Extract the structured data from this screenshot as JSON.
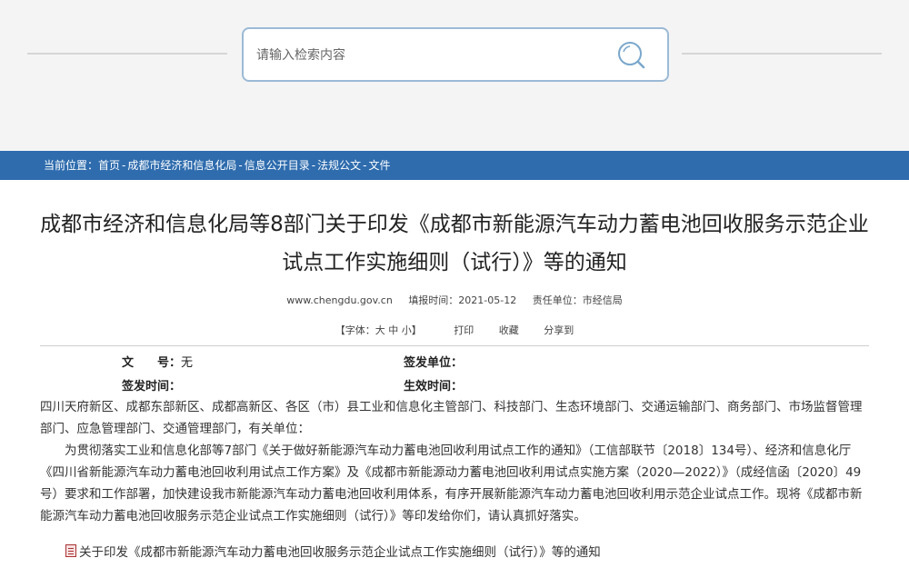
{
  "search": {
    "placeholder": "请输入检索内容"
  },
  "breadcrumb": {
    "prefix": "当前位置：",
    "items": [
      "首页",
      "成都市经济和信息化局",
      "信息公开目录",
      "法规公文",
      "文件"
    ],
    "separator": " - "
  },
  "article": {
    "title_line1": "成都市经济和信息化局等8部门关于印发《成都市新能源汽车动力蓄电池回收服务示范企业",
    "title_line2": "试点工作实施细则（试行）》等的通知",
    "meta": {
      "site": "www.chengdu.gov.cn",
      "date": "填报时间：2021-05-12",
      "unit": "责任单位：市经信局"
    },
    "tools": {
      "font_size": "【字体：大 中 小】",
      "print": "打印",
      "favorite": "收藏",
      "share": "分享到"
    },
    "info": {
      "doc_no_label": "文　　号：",
      "doc_no_value": "无",
      "issuer_label": "签发单位：",
      "issuer_value": "",
      "issue_time_label": "签发时间：",
      "issue_time_value": "",
      "effective_label": "生效时间：",
      "effective_value": ""
    },
    "paragraphs": [
      "四川天府新区、成都东部新区、成都高新区、各区（市）县工业和信息化主管部门、科技部门、生态环境部门、交通运输部门、商务部门、市场监督管理部门、应急管理部门、交通管理部门，有关单位：",
      "为贯彻落实工业和信息化部等7部门《关于做好新能源汽车动力蓄电池回收利用试点工作的通知》（工信部联节〔2018〕134号）、经济和信息化厅《四川省新能源汽车动力蓄电池回收利用试点工作方案》及《成都市新能源动力蓄电池回收利用试点实施方案（2020—2022）》（成经信函〔2020〕49号）要求和工作部署，加快建设我市新能源汽车动力蓄电池回收利用体系，有序开展新能源汽车动力蓄电池回收利用示范企业试点工作。现将《成都市新能源汽车动力蓄电池回收服务示范企业试点工作实施细则（试行）》等印发给你们，请认真抓好落实。"
    ],
    "attachment": "关于印发《成都市新能源汽车动力蓄电池回收服务示范企业试点工作实施细则（试行）》等的通知"
  },
  "colors": {
    "breadcrumb_bg": "#2e6cae",
    "search_border": "#9bbad6",
    "header_bg": "#f4f4f4"
  }
}
